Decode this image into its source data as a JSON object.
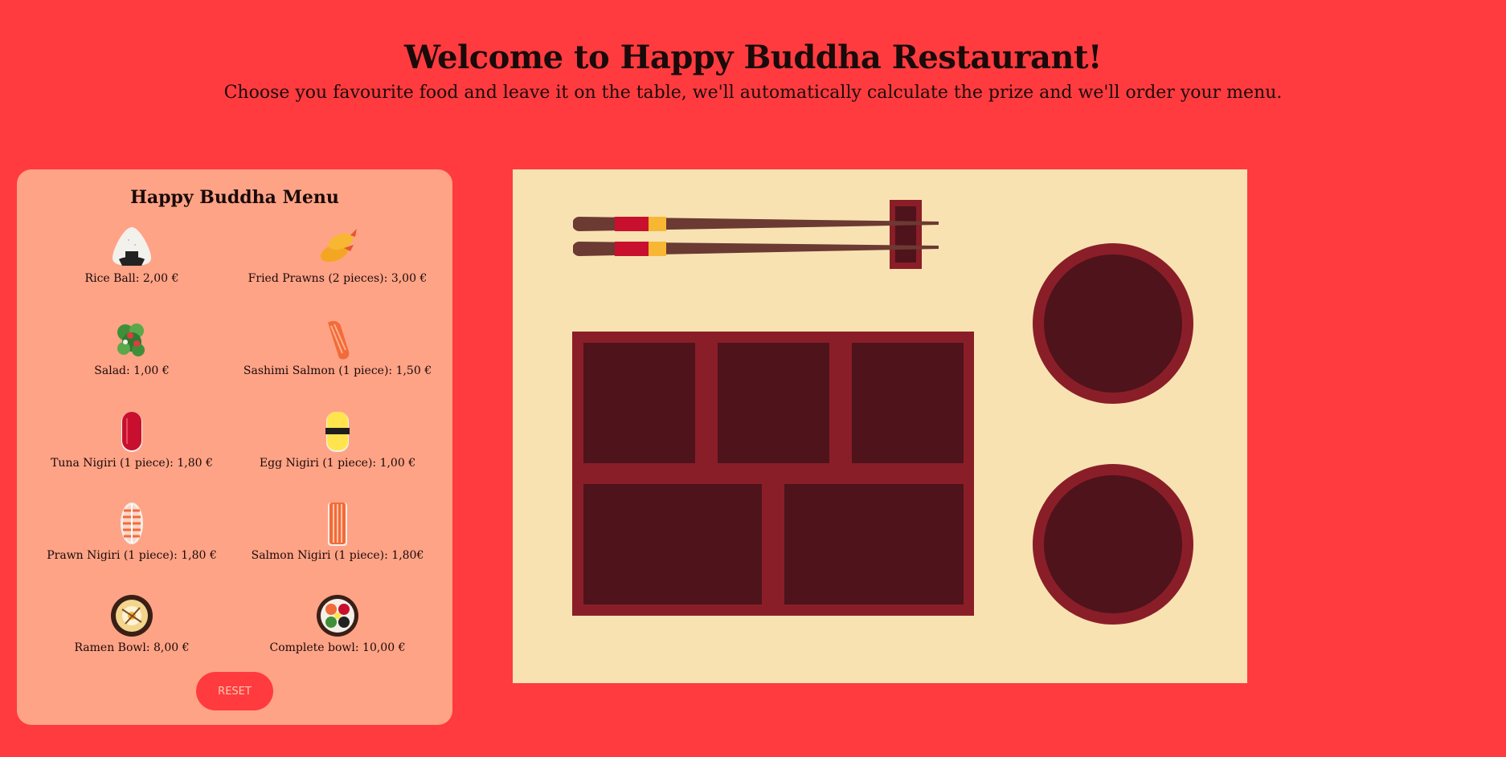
{
  "header": {
    "title": "Welcome to Happy Buddha Restaurant!",
    "subtitle": "Choose you favourite food and leave it on the table, we'll automatically calculate the prize and we'll order your menu."
  },
  "menu": {
    "title": "Happy Buddha Menu",
    "items": [
      {
        "label": "Rice Ball: 2,00 €",
        "icon": "rice-ball-icon"
      },
      {
        "label": "Fried Prawns (2 pieces): 3,00 €",
        "icon": "fried-prawns-icon"
      },
      {
        "label": "Salad: 1,00 €",
        "icon": "salad-icon"
      },
      {
        "label": "Sashimi Salmon (1 piece): 1,50 €",
        "icon": "sashimi-salmon-icon"
      },
      {
        "label": "Tuna Nigiri (1 piece): 1,80 €",
        "icon": "tuna-nigiri-icon"
      },
      {
        "label": "Egg Nigiri (1 piece): 1,00 €",
        "icon": "egg-nigiri-icon"
      },
      {
        "label": "Prawn Nigiri (1 piece): 1,80 €",
        "icon": "prawn-nigiri-icon"
      },
      {
        "label": "Salmon Nigiri (1 piece): 1,80€",
        "icon": "salmon-nigiri-icon"
      },
      {
        "label": "Ramen Bowl: 8,00 €",
        "icon": "ramen-bowl-icon"
      },
      {
        "label": "Complete bowl: 10,00 €",
        "icon": "complete-bowl-icon"
      }
    ],
    "reset_label": "RESET"
  },
  "colors": {
    "background": "#ff3b3f",
    "menu_panel": "#ffa386",
    "table_mat": "#f8e2b2",
    "tray_frame": "#8a1e28",
    "tray_cell": "#4e131b"
  }
}
